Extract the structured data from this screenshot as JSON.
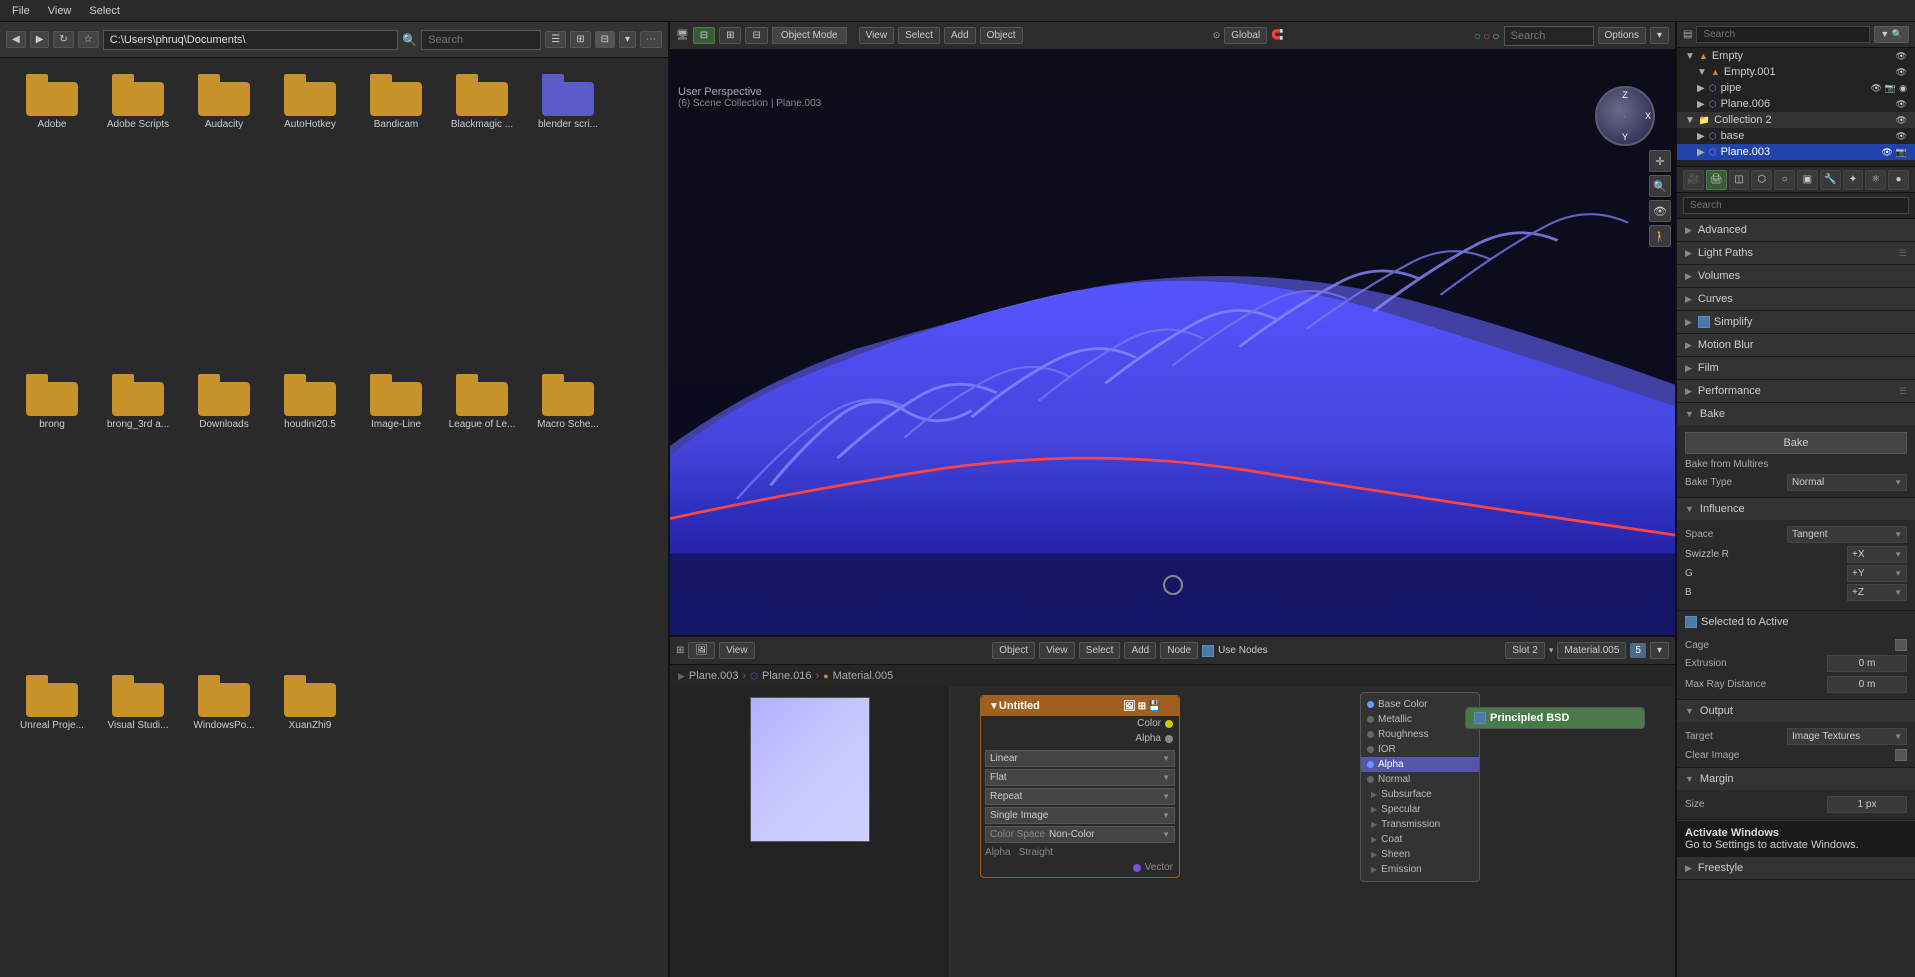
{
  "topbar": {
    "menus": [
      "File",
      "View",
      "Select"
    ]
  },
  "filebrowser": {
    "path": "C:\\Users\\phruq\\Documents\\",
    "search_placeholder": "Search",
    "items": [
      {
        "name": "Adobe",
        "type": "folder"
      },
      {
        "name": "Adobe Scripts",
        "type": "folder"
      },
      {
        "name": "Audacity",
        "type": "folder"
      },
      {
        "name": "AutoHotkey",
        "type": "folder"
      },
      {
        "name": "Bandicam",
        "type": "folder"
      },
      {
        "name": "Blackmagic ...",
        "type": "folder"
      },
      {
        "name": "blender scri...",
        "type": "folder"
      },
      {
        "name": "brong",
        "type": "folder"
      },
      {
        "name": "brong_3rd a...",
        "type": "folder"
      },
      {
        "name": "Downloads",
        "type": "folder"
      },
      {
        "name": "houdini20.5",
        "type": "folder"
      },
      {
        "name": "Image-Line",
        "type": "folder"
      },
      {
        "name": "League of Le...",
        "type": "folder"
      },
      {
        "name": "Macro Sche...",
        "type": "folder"
      },
      {
        "name": "Unreal Proje...",
        "type": "folder"
      },
      {
        "name": "Visual Studi...",
        "type": "folder"
      },
      {
        "name": "WindowsPo...",
        "type": "folder"
      },
      {
        "name": "XuanZhi9",
        "type": "folder"
      }
    ]
  },
  "viewport3d": {
    "label": "User Perspective",
    "scene_label": "(6) Scene Collection | Plane.003",
    "mode": "Object Mode",
    "menus": [
      "View",
      "Select",
      "Add",
      "Object"
    ],
    "header_mode": "Global",
    "search_placeholder": "Search",
    "options": "Options"
  },
  "outliner": {
    "search_placeholder": "Search",
    "items": [
      {
        "name": "Empty",
        "indent": 2,
        "type": "empty",
        "icon": "▼"
      },
      {
        "name": "Empty.001",
        "indent": 2,
        "type": "empty",
        "icon": "▼"
      },
      {
        "name": "pipe",
        "indent": 2,
        "type": "mesh",
        "icon": "▼"
      },
      {
        "name": "Plane.006",
        "indent": 2,
        "type": "plane",
        "icon": "▼"
      },
      {
        "name": "Collection 2",
        "indent": 1,
        "type": "collection",
        "icon": "▼"
      },
      {
        "name": "base",
        "indent": 2,
        "type": "mesh",
        "icon": "▼"
      },
      {
        "name": "Plane.003",
        "indent": 2,
        "type": "plane",
        "icon": "▼",
        "selected": true
      }
    ]
  },
  "properties": {
    "search_placeholder": "Search",
    "sections": [
      {
        "name": "Advanced",
        "expanded": false
      },
      {
        "name": "Light Paths",
        "expanded": false
      },
      {
        "name": "Volumes",
        "expanded": false
      },
      {
        "name": "Curves",
        "expanded": false
      },
      {
        "name": "Simplify",
        "expanded": true,
        "checked": true
      },
      {
        "name": "Motion Blur",
        "expanded": false
      },
      {
        "name": "Film",
        "expanded": false
      },
      {
        "name": "Performance",
        "expanded": false
      },
      {
        "name": "Bake",
        "expanded": true
      },
      {
        "name": "Output",
        "expanded": true
      },
      {
        "name": "Margin",
        "expanded": true
      },
      {
        "name": "Freestyle",
        "expanded": false
      }
    ],
    "bake": {
      "bake_btn": "Bake",
      "bake_from_multires": "Bake from Multires",
      "bake_type_label": "Bake Type",
      "bake_type_value": "Normal"
    },
    "influence": {
      "space_label": "Space",
      "space_value": "Tangent",
      "swizzle_r": "R",
      "swizzle_r_val": "+X",
      "swizzle_g": "G",
      "swizzle_g_val": "+Y",
      "swizzle_b": "B",
      "swizzle_b_val": "+Z"
    },
    "selected_to_active": {
      "label": "Selected to Active",
      "cage": "Cage",
      "extrusion_label": "Extrusion",
      "extrusion_val": "0 m",
      "max_ray_label": "Max Ray Distance",
      "max_ray_val": "0 m"
    },
    "output": {
      "target_label": "Target",
      "target_val": "Image Textures",
      "clear_image": "Clear Image"
    },
    "margin": {
      "size_label": "Size",
      "size_val": "1 px"
    }
  },
  "node_editor": {
    "title": "Untitled",
    "view_menu": "View",
    "use_nodes": "Use Nodes",
    "mode": "Object",
    "slot": "Slot 2",
    "material": "Material.005",
    "breadcrumb": [
      "Plane.003",
      "Plane.016",
      "Material.005"
    ],
    "principled_bsdf_label": "Principled BSD",
    "img_texture": {
      "title": "Untitled",
      "color_label": "Color",
      "alpha_label": "Alpha",
      "interpolation": "Linear",
      "projection": "Flat",
      "extension": "Repeat",
      "source": "Single Image",
      "color_space_label": "Color Space",
      "color_space_val": "Non-Color",
      "alpha_label2": "Alpha",
      "alpha_val": "Straight",
      "vector_label": "Vector"
    },
    "input_list": {
      "items": [
        {
          "name": "Base Color",
          "active": true
        },
        {
          "name": "Metallic"
        },
        {
          "name": "Roughness"
        },
        {
          "name": "IOR"
        },
        {
          "name": "Alpha",
          "highlighted": true
        },
        {
          "name": "Normal"
        },
        {
          "name": "Subsurface"
        },
        {
          "name": "Specular"
        },
        {
          "name": "Transmission"
        },
        {
          "name": "Coat"
        },
        {
          "name": "Sheen"
        },
        {
          "name": "Emission"
        }
      ]
    }
  },
  "activate_windows": {
    "title": "Activate Windows",
    "text": "Go to Settings to activate Windows."
  }
}
